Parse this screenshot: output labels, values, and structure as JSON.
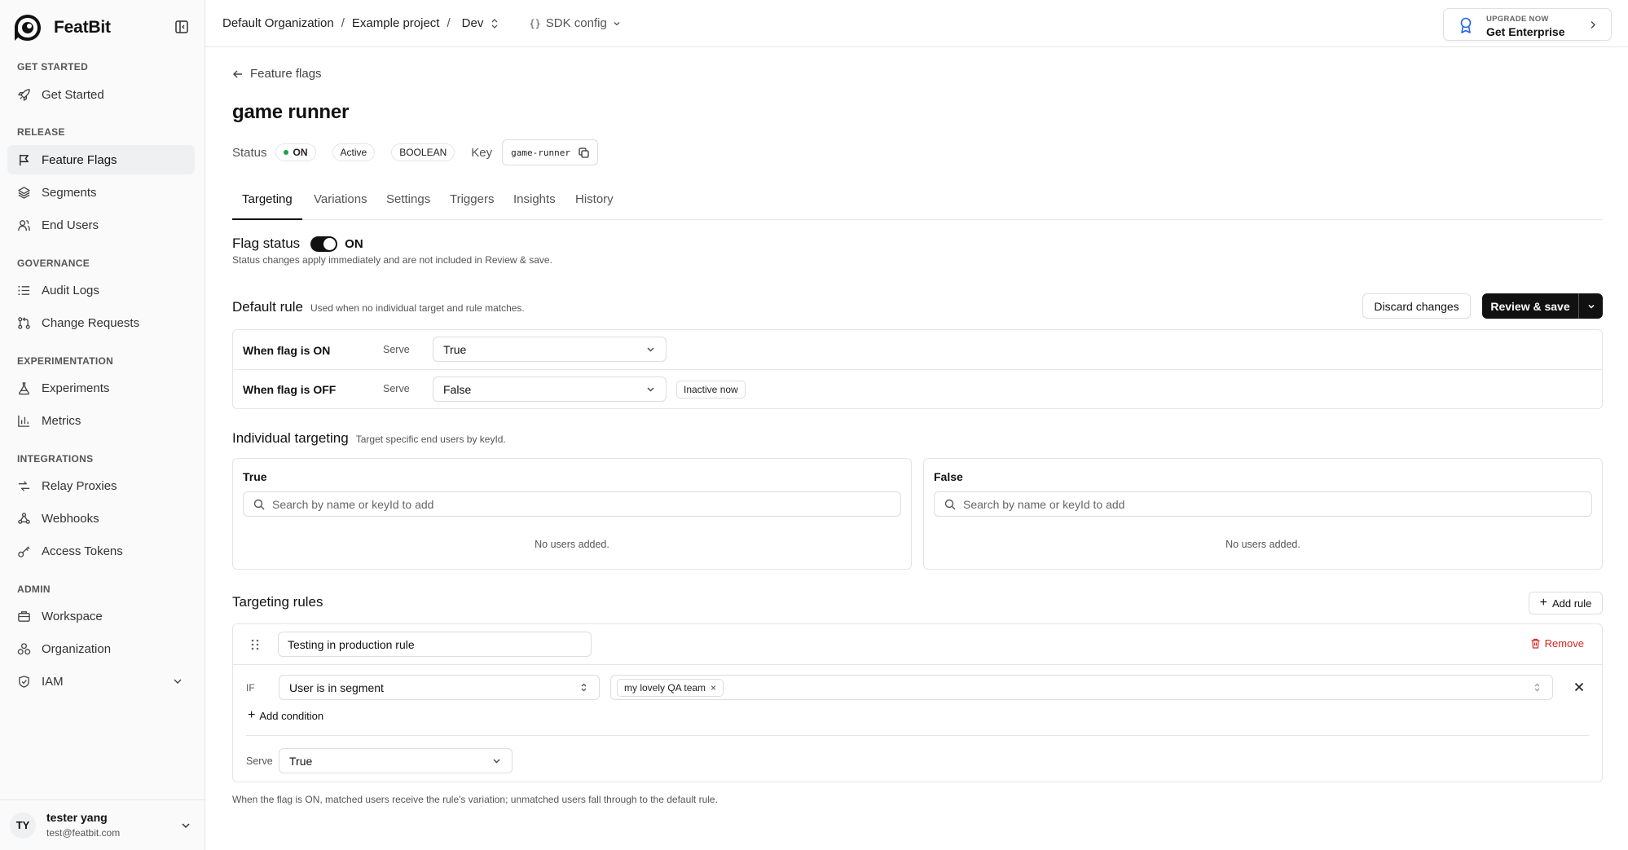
{
  "app": {
    "name": "FeatBit"
  },
  "sidebar": {
    "sections": [
      {
        "title": "GET STARTED",
        "items": [
          {
            "label": "Get Started",
            "icon": "rocket-icon"
          }
        ]
      },
      {
        "title": "RELEASE",
        "items": [
          {
            "label": "Feature Flags",
            "icon": "flag-icon",
            "active": true
          },
          {
            "label": "Segments",
            "icon": "layers-icon"
          },
          {
            "label": "End Users",
            "icon": "users-icon"
          }
        ]
      },
      {
        "title": "GOVERNANCE",
        "items": [
          {
            "label": "Audit Logs",
            "icon": "list-icon"
          },
          {
            "label": "Change Requests",
            "icon": "git-pull-request-icon"
          }
        ]
      },
      {
        "title": "EXPERIMENTATION",
        "items": [
          {
            "label": "Experiments",
            "icon": "flask-icon"
          },
          {
            "label": "Metrics",
            "icon": "bar-chart-icon"
          }
        ]
      },
      {
        "title": "INTEGRATIONS",
        "items": [
          {
            "label": "Relay Proxies",
            "icon": "relay-icon"
          },
          {
            "label": "Webhooks",
            "icon": "webhook-icon"
          },
          {
            "label": "Access Tokens",
            "icon": "key-icon"
          }
        ]
      },
      {
        "title": "ADMIN",
        "items": [
          {
            "label": "Workspace",
            "icon": "workspace-icon"
          },
          {
            "label": "Organization",
            "icon": "organization-icon"
          },
          {
            "label": "IAM",
            "icon": "shield-icon"
          }
        ]
      }
    ],
    "user": {
      "initials": "TY",
      "name": "tester yang",
      "email": "test@featbit.com"
    }
  },
  "topbar": {
    "organization": "Default Organization",
    "project": "Example project",
    "environment": "Dev",
    "sdk_config": "SDK config",
    "upgrade_small": "UPGRADE NOW",
    "upgrade_big": "Get Enterprise"
  },
  "flag": {
    "back_label": "Feature flags",
    "name": "game runner",
    "status_label": "Status",
    "status_value": "ON",
    "active_badge": "Active",
    "type_badge": "BOOLEAN",
    "key_label": "Key",
    "key_value": "game-runner"
  },
  "tabs": [
    "Targeting",
    "Variations",
    "Settings",
    "Triggers",
    "Insights",
    "History"
  ],
  "flag_status": {
    "title": "Flag status",
    "state": "ON",
    "note": "Status changes apply immediately and are not included in Review & save."
  },
  "default_rule": {
    "title": "Default rule",
    "subtitle": "Used when no individual target and rule matches.",
    "discard_label": "Discard changes",
    "review_label": "Review & save",
    "rows": [
      {
        "label": "When flag is ON",
        "serve_label": "Serve",
        "value": "True"
      },
      {
        "label": "When flag is OFF",
        "serve_label": "Serve",
        "value": "False",
        "badge": "Inactive now"
      }
    ]
  },
  "individual_targeting": {
    "title": "Individual targeting",
    "subtitle": "Target specific end users by keyId.",
    "columns": [
      {
        "title": "True",
        "placeholder": "Search by name or keyId to add",
        "empty": "No users added."
      },
      {
        "title": "False",
        "placeholder": "Search by name or keyId to add",
        "empty": "No users added."
      }
    ]
  },
  "targeting_rules": {
    "title": "Targeting rules",
    "add_rule_label": "Add rule",
    "rules": [
      {
        "name": "Testing in production rule",
        "remove_label": "Remove",
        "if_label": "IF",
        "condition_op": "User is in segment",
        "segment_chip": "my lovely QA team",
        "add_condition_label": "Add condition",
        "serve_label": "Serve",
        "serve_value": "True"
      }
    ],
    "footer_note": "When the flag is ON, matched users receive the rule's variation; unmatched users fall through to the default rule."
  },
  "colors": {
    "accent": "#111111",
    "status_on": "#16a34a",
    "danger": "#dc2626",
    "enterprise_icon": "#2563eb"
  }
}
